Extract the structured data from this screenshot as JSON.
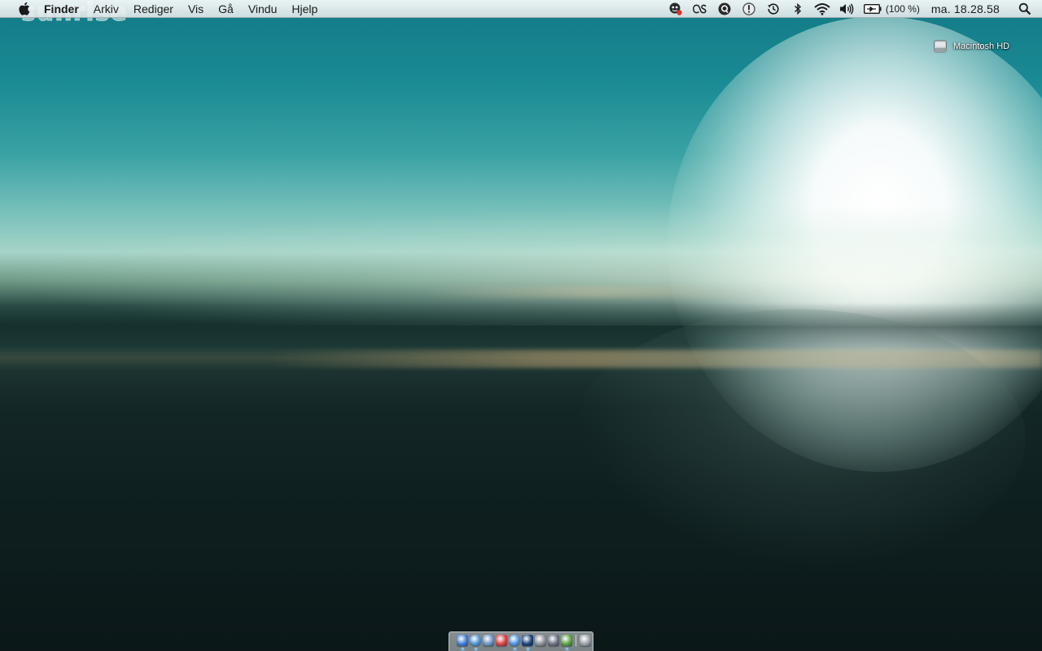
{
  "menubar": {
    "apple_icon": "apple-icon",
    "app_name": "Finder",
    "menus": [
      "Arkiv",
      "Rediger",
      "Vis",
      "Gå",
      "Vindu",
      "Hjelp"
    ],
    "status_icons": [
      "chat-status-icon",
      "lastfm-icon",
      "quicksilver-icon",
      "alert-icon",
      "time-machine-icon",
      "bluetooth-icon",
      "wifi-icon",
      "volume-icon"
    ],
    "battery_percent": "(100 %)",
    "battery_level": 1.0,
    "clock": "ma. 18.28.58",
    "spotlight_icon": "spotlight-search-icon"
  },
  "desktop": {
    "wallpaper_text": "sunrise",
    "icons": [
      {
        "label": "Macintosh HD",
        "icon": "hard-drive-icon"
      }
    ]
  },
  "dock": {
    "items": [
      {
        "name": "finder",
        "color": "#3d7ad6",
        "running": true
      },
      {
        "name": "safari",
        "color": "#4a90d0",
        "running": true
      },
      {
        "name": "mail",
        "color": "#6a8fc0",
        "running": false
      },
      {
        "name": "ical",
        "color": "#d84040",
        "running": false
      },
      {
        "name": "itunes",
        "color": "#4a8ee0",
        "running": true
      },
      {
        "name": "photoshop",
        "color": "#1a3e78",
        "running": true
      },
      {
        "name": "system-preferences",
        "color": "#8a8f96",
        "running": false
      },
      {
        "name": "script-editor",
        "color": "#6a6f80",
        "running": false
      },
      {
        "name": "adium",
        "color": "#5aa040",
        "running": true
      },
      {
        "name": "trash",
        "color": "#9aa0a6",
        "running": false
      }
    ]
  },
  "colors": {
    "menubar_text": "#1a1a1a",
    "running_indicator": "#7ec8ff"
  }
}
